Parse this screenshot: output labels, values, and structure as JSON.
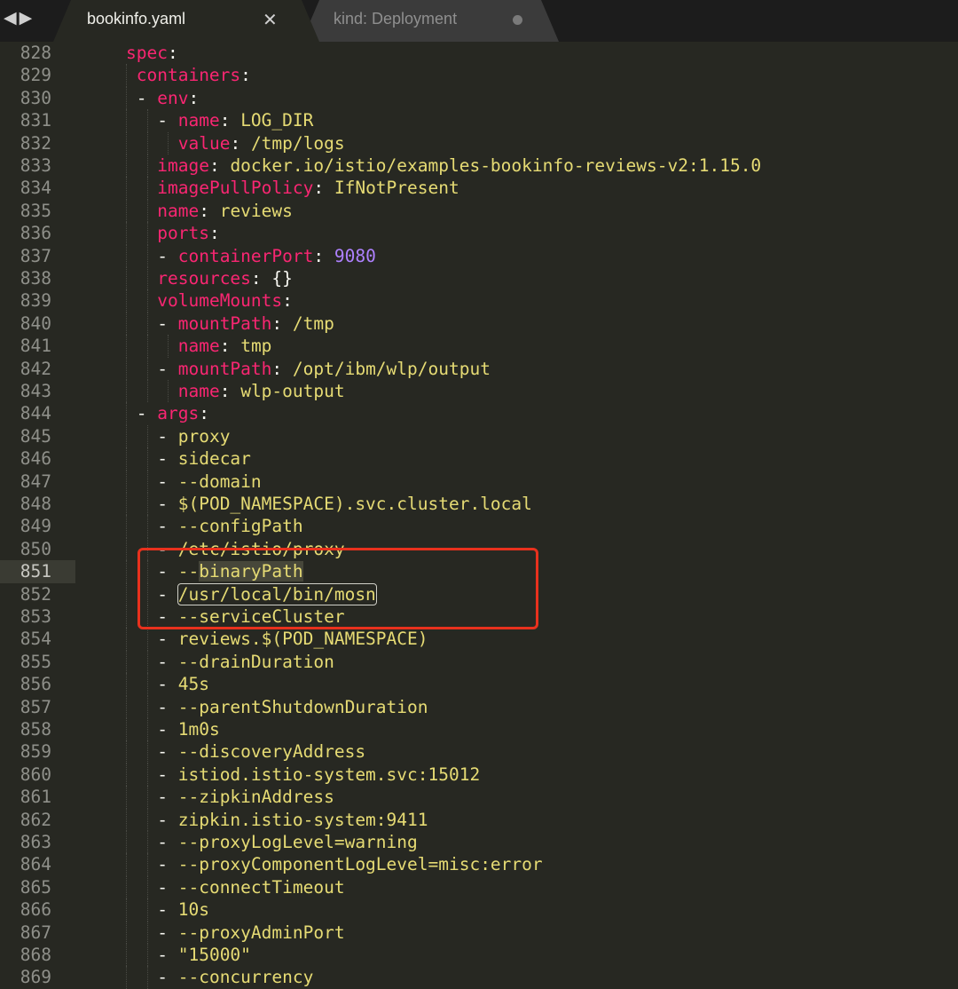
{
  "tabs": [
    {
      "label": "bookinfo.yaml",
      "active": true,
      "close_icon": "close-icon"
    },
    {
      "label": "kind: Deployment",
      "active": false,
      "modified_icon": "dirty-dot-icon"
    }
  ],
  "nav_icon": "back-forward-arrows-icon",
  "colors": {
    "key": "#f92672",
    "value": "#e6db74",
    "number": "#ae81ff",
    "annotation": "#e8311d"
  },
  "current_line": 851,
  "lines": [
    {
      "n": "828",
      "indent": 4,
      "seg": [
        [
          "k",
          "spec"
        ],
        [
          "p",
          ":"
        ]
      ]
    },
    {
      "n": "829",
      "indent": 5,
      "seg": [
        [
          "k",
          "containers"
        ],
        [
          "p",
          ":"
        ]
      ]
    },
    {
      "n": "830",
      "indent": 5,
      "seg": [
        [
          "p",
          "- "
        ],
        [
          "k",
          "env"
        ],
        [
          "p",
          ":"
        ]
      ]
    },
    {
      "n": "831",
      "indent": 7,
      "seg": [
        [
          "p",
          "- "
        ],
        [
          "k",
          "name"
        ],
        [
          "p",
          ": "
        ],
        [
          "v",
          "LOG_DIR"
        ]
      ]
    },
    {
      "n": "832",
      "indent": 9,
      "seg": [
        [
          "k",
          "value"
        ],
        [
          "p",
          ": "
        ],
        [
          "v",
          "/tmp/logs"
        ]
      ]
    },
    {
      "n": "833",
      "indent": 7,
      "seg": [
        [
          "k",
          "image"
        ],
        [
          "p",
          ": "
        ],
        [
          "v",
          "docker.io/istio/examples-bookinfo-reviews-v2:1.15.0"
        ]
      ]
    },
    {
      "n": "834",
      "indent": 7,
      "seg": [
        [
          "k",
          "imagePullPolicy"
        ],
        [
          "p",
          ": "
        ],
        [
          "v",
          "IfNotPresent"
        ]
      ]
    },
    {
      "n": "835",
      "indent": 7,
      "seg": [
        [
          "k",
          "name"
        ],
        [
          "p",
          ": "
        ],
        [
          "v",
          "reviews"
        ]
      ]
    },
    {
      "n": "836",
      "indent": 7,
      "seg": [
        [
          "k",
          "ports"
        ],
        [
          "p",
          ":"
        ]
      ]
    },
    {
      "n": "837",
      "indent": 7,
      "seg": [
        [
          "p",
          "- "
        ],
        [
          "k",
          "containerPort"
        ],
        [
          "p",
          ": "
        ],
        [
          "num",
          "9080"
        ]
      ]
    },
    {
      "n": "838",
      "indent": 7,
      "seg": [
        [
          "k",
          "resources"
        ],
        [
          "p",
          ": {}"
        ]
      ]
    },
    {
      "n": "839",
      "indent": 7,
      "seg": [
        [
          "k",
          "volumeMounts"
        ],
        [
          "p",
          ":"
        ]
      ]
    },
    {
      "n": "840",
      "indent": 7,
      "seg": [
        [
          "p",
          "- "
        ],
        [
          "k",
          "mountPath"
        ],
        [
          "p",
          ": "
        ],
        [
          "v",
          "/tmp"
        ]
      ]
    },
    {
      "n": "841",
      "indent": 9,
      "seg": [
        [
          "k",
          "name"
        ],
        [
          "p",
          ": "
        ],
        [
          "v",
          "tmp"
        ]
      ]
    },
    {
      "n": "842",
      "indent": 7,
      "seg": [
        [
          "p",
          "- "
        ],
        [
          "k",
          "mountPath"
        ],
        [
          "p",
          ": "
        ],
        [
          "v",
          "/opt/ibm/wlp/output"
        ]
      ]
    },
    {
      "n": "843",
      "indent": 9,
      "seg": [
        [
          "k",
          "name"
        ],
        [
          "p",
          ": "
        ],
        [
          "v",
          "wlp-output"
        ]
      ]
    },
    {
      "n": "844",
      "indent": 5,
      "seg": [
        [
          "p",
          "- "
        ],
        [
          "k",
          "args"
        ],
        [
          "p",
          ":"
        ]
      ]
    },
    {
      "n": "845",
      "indent": 7,
      "seg": [
        [
          "p",
          "- "
        ],
        [
          "v",
          "proxy"
        ]
      ]
    },
    {
      "n": "846",
      "indent": 7,
      "seg": [
        [
          "p",
          "- "
        ],
        [
          "v",
          "sidecar"
        ]
      ]
    },
    {
      "n": "847",
      "indent": 7,
      "seg": [
        [
          "p",
          "- "
        ],
        [
          "v",
          "--domain"
        ]
      ]
    },
    {
      "n": "848",
      "indent": 7,
      "seg": [
        [
          "p",
          "- "
        ],
        [
          "v",
          "$(POD_NAMESPACE).svc.cluster.local"
        ]
      ]
    },
    {
      "n": "849",
      "indent": 7,
      "seg": [
        [
          "p",
          "- "
        ],
        [
          "v",
          "--configPath"
        ]
      ]
    },
    {
      "n": "850",
      "indent": 7,
      "seg": [
        [
          "p",
          "- "
        ],
        [
          "v",
          "/etc/istio/proxy"
        ]
      ]
    },
    {
      "n": "851",
      "indent": 7,
      "seg": [
        [
          "p",
          "- "
        ],
        [
          "v",
          "--"
        ],
        [
          "vsel",
          "binaryPath"
        ]
      ]
    },
    {
      "n": "852",
      "indent": 7,
      "seg": [
        [
          "p",
          "- "
        ],
        [
          "vbox",
          "/usr/local/bin/mosn"
        ]
      ]
    },
    {
      "n": "853",
      "indent": 7,
      "seg": [
        [
          "p",
          "- "
        ],
        [
          "v",
          "--serviceCluster"
        ]
      ]
    },
    {
      "n": "854",
      "indent": 7,
      "seg": [
        [
          "p",
          "- "
        ],
        [
          "v",
          "reviews.$(POD_NAMESPACE)"
        ]
      ]
    },
    {
      "n": "855",
      "indent": 7,
      "seg": [
        [
          "p",
          "- "
        ],
        [
          "v",
          "--drainDuration"
        ]
      ]
    },
    {
      "n": "856",
      "indent": 7,
      "seg": [
        [
          "p",
          "- "
        ],
        [
          "v",
          "45s"
        ]
      ]
    },
    {
      "n": "857",
      "indent": 7,
      "seg": [
        [
          "p",
          "- "
        ],
        [
          "v",
          "--parentShutdownDuration"
        ]
      ]
    },
    {
      "n": "858",
      "indent": 7,
      "seg": [
        [
          "p",
          "- "
        ],
        [
          "v",
          "1m0s"
        ]
      ]
    },
    {
      "n": "859",
      "indent": 7,
      "seg": [
        [
          "p",
          "- "
        ],
        [
          "v",
          "--discoveryAddress"
        ]
      ]
    },
    {
      "n": "860",
      "indent": 7,
      "seg": [
        [
          "p",
          "- "
        ],
        [
          "v",
          "istiod.istio-system.svc:15012"
        ]
      ]
    },
    {
      "n": "861",
      "indent": 7,
      "seg": [
        [
          "p",
          "- "
        ],
        [
          "v",
          "--zipkinAddress"
        ]
      ]
    },
    {
      "n": "862",
      "indent": 7,
      "seg": [
        [
          "p",
          "- "
        ],
        [
          "v",
          "zipkin.istio-system:9411"
        ]
      ]
    },
    {
      "n": "863",
      "indent": 7,
      "seg": [
        [
          "p",
          "- "
        ],
        [
          "v",
          "--proxyLogLevel=warning"
        ]
      ]
    },
    {
      "n": "864",
      "indent": 7,
      "seg": [
        [
          "p",
          "- "
        ],
        [
          "v",
          "--proxyComponentLogLevel=misc:error"
        ]
      ]
    },
    {
      "n": "865",
      "indent": 7,
      "seg": [
        [
          "p",
          "- "
        ],
        [
          "v",
          "--connectTimeout"
        ]
      ]
    },
    {
      "n": "866",
      "indent": 7,
      "seg": [
        [
          "p",
          "- "
        ],
        [
          "v",
          "10s"
        ]
      ]
    },
    {
      "n": "867",
      "indent": 7,
      "seg": [
        [
          "p",
          "- "
        ],
        [
          "v",
          "--proxyAdminPort"
        ]
      ]
    },
    {
      "n": "868",
      "indent": 7,
      "seg": [
        [
          "p",
          "- "
        ],
        [
          "v",
          "\"15000\""
        ]
      ]
    },
    {
      "n": "869",
      "indent": 7,
      "seg": [
        [
          "p",
          "- "
        ],
        [
          "v",
          "--concurrency"
        ]
      ]
    }
  ]
}
